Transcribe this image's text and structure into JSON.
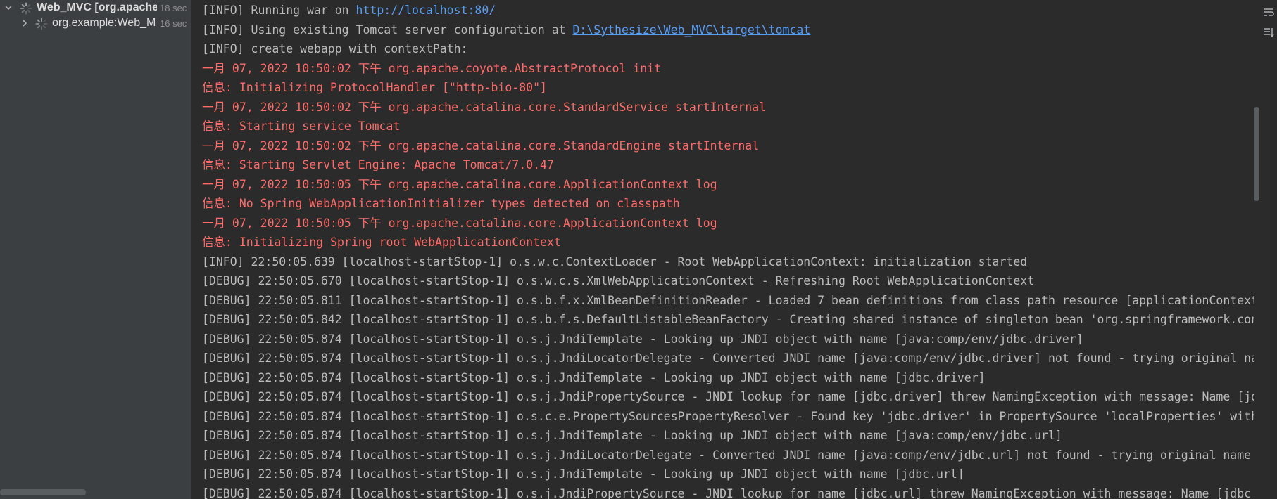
{
  "run_tree": {
    "items": [
      {
        "name": "Web_MVC [org.apache",
        "time": "18 sec",
        "expanded": true,
        "icon": "spinner-icon"
      },
      {
        "name": "org.example:Web_M",
        "time": "16 sec",
        "expanded": false,
        "icon": "spinner-icon"
      }
    ]
  },
  "console": {
    "lines": [
      {
        "type": "info",
        "text": "[INFO] Running war on ",
        "link": "http://localhost:80/"
      },
      {
        "type": "info",
        "text": "[INFO] Using existing Tomcat server configuration at ",
        "link": "D:\\Sythesize\\Web_MVC\\target\\tomcat"
      },
      {
        "type": "info",
        "text": "[INFO] create webapp with contextPath:"
      },
      {
        "type": "error",
        "text": "一月 07, 2022 10:50:02 下午 org.apache.coyote.AbstractProtocol init"
      },
      {
        "type": "error",
        "text": "信息: Initializing ProtocolHandler [\"http-bio-80\"]"
      },
      {
        "type": "error",
        "text": "一月 07, 2022 10:50:02 下午 org.apache.catalina.core.StandardService startInternal"
      },
      {
        "type": "error",
        "text": "信息: Starting service Tomcat"
      },
      {
        "type": "error",
        "text": "一月 07, 2022 10:50:02 下午 org.apache.catalina.core.StandardEngine startInternal"
      },
      {
        "type": "error",
        "text": "信息: Starting Servlet Engine: Apache Tomcat/7.0.47"
      },
      {
        "type": "error",
        "text": "一月 07, 2022 10:50:05 下午 org.apache.catalina.core.ApplicationContext log"
      },
      {
        "type": "error",
        "text": "信息: No Spring WebApplicationInitializer types detected on classpath"
      },
      {
        "type": "error",
        "text": "一月 07, 2022 10:50:05 下午 org.apache.catalina.core.ApplicationContext log"
      },
      {
        "type": "error",
        "text": "信息: Initializing Spring root WebApplicationContext"
      },
      {
        "type": "info",
        "text": "[INFO] 22:50:05.639 [localhost-startStop-1] o.s.w.c.ContextLoader - Root WebApplicationContext: initialization started"
      },
      {
        "type": "info",
        "text": "[DEBUG] 22:50:05.670 [localhost-startStop-1] o.s.w.c.s.XmlWebApplicationContext - Refreshing Root WebApplicationContext"
      },
      {
        "type": "info",
        "text": "[DEBUG] 22:50:05.811 [localhost-startStop-1] o.s.b.f.x.XmlBeanDefinitionReader - Loaded 7 bean definitions from class path resource [applicationContext"
      },
      {
        "type": "info",
        "text": "[DEBUG] 22:50:05.842 [localhost-startStop-1] o.s.b.f.s.DefaultListableBeanFactory - Creating shared instance of singleton bean 'org.springframework.con"
      },
      {
        "type": "info",
        "text": "[DEBUG] 22:50:05.874 [localhost-startStop-1] o.s.j.JndiTemplate - Looking up JNDI object with name [java:comp/env/jdbc.driver]"
      },
      {
        "type": "info",
        "text": "[DEBUG] 22:50:05.874 [localhost-startStop-1] o.s.j.JndiLocatorDelegate - Converted JNDI name [java:comp/env/jdbc.driver] not found - trying original na"
      },
      {
        "type": "info",
        "text": "[DEBUG] 22:50:05.874 [localhost-startStop-1] o.s.j.JndiTemplate - Looking up JNDI object with name [jdbc.driver]"
      },
      {
        "type": "info",
        "text": "[DEBUG] 22:50:05.874 [localhost-startStop-1] o.s.j.JndiPropertySource - JNDI lookup for name [jdbc.driver] threw NamingException with message: Name [jd"
      },
      {
        "type": "info",
        "text": "[DEBUG] 22:50:05.874 [localhost-startStop-1] o.s.c.e.PropertySourcesPropertyResolver - Found key 'jdbc.driver' in PropertySource 'localProperties' with"
      },
      {
        "type": "info",
        "text": "[DEBUG] 22:50:05.874 [localhost-startStop-1] o.s.j.JndiTemplate - Looking up JNDI object with name [java:comp/env/jdbc.url]"
      },
      {
        "type": "info",
        "text": "[DEBUG] 22:50:05.874 [localhost-startStop-1] o.s.j.JndiLocatorDelegate - Converted JNDI name [java:comp/env/jdbc.url] not found - trying original name"
      },
      {
        "type": "info",
        "text": "[DEBUG] 22:50:05.874 [localhost-startStop-1] o.s.j.JndiTemplate - Looking up JNDI object with name [jdbc.url]"
      },
      {
        "type": "info",
        "text": "[DEBUG] 22:50:05.874 [localhost-startStop-1] o.s.j.JndiPropertySource - JNDI lookup for name [jdbc.url] threw NamingException with message: Name [jdbc."
      }
    ]
  },
  "colors": {
    "console_bg": "#2b2b2b",
    "tree_bg": "#3c3f41",
    "info_text": "#bbbbbb",
    "error_text": "#ff6b68",
    "link": "#589df6"
  },
  "right_toolbar": {
    "icons": [
      "wrap-lines-icon",
      "scroll-to-end-icon"
    ]
  }
}
